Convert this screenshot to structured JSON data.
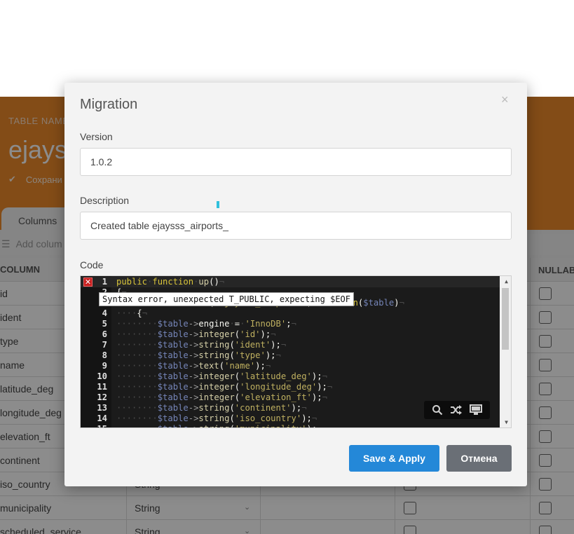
{
  "background": {
    "table_name_label": "TABLE NAME",
    "table_title": "ejays",
    "saved_text": "Сохрани",
    "tab_columns": "Columns",
    "add_column": "Add colum",
    "header": {
      "column": "COLUMN",
      "nullable": "NULLABL"
    },
    "rows": [
      {
        "name": "id",
        "type": ""
      },
      {
        "name": "ident",
        "type": ""
      },
      {
        "name": "type",
        "type": ""
      },
      {
        "name": "name",
        "type": ""
      },
      {
        "name": "latitude_deg",
        "type": ""
      },
      {
        "name": "longitude_deg",
        "type": ""
      },
      {
        "name": "elevation_ft",
        "type": ""
      },
      {
        "name": "continent",
        "type": ""
      },
      {
        "name": "iso_country",
        "type": "String"
      },
      {
        "name": "municipality",
        "type": "String"
      },
      {
        "name": "scheduled_service",
        "type": "String"
      }
    ]
  },
  "modal": {
    "title": "Migration",
    "close_glyph": "×",
    "version_label": "Version",
    "version_value": "1.0.2",
    "description_label": "Description",
    "description_value": "Created table ejaysss_airports_",
    "code_label": "Code",
    "error_tooltip": "Syntax error, unexpected T_PUBLIC, expecting $EOF",
    "code_lines": [
      {
        "n": "1",
        "text": "public function up()"
      },
      {
        "n": "2",
        "text": "{"
      },
      {
        "n": "3",
        "text": "    Schema::create('ejaysss_airports', function($table)"
      },
      {
        "n": "4",
        "text": "    {"
      },
      {
        "n": "5",
        "text": "        $table->engine = 'InnoDB';"
      },
      {
        "n": "6",
        "text": "        $table->integer('id');"
      },
      {
        "n": "7",
        "text": "        $table->string('ident');"
      },
      {
        "n": "8",
        "text": "        $table->string('type');"
      },
      {
        "n": "9",
        "text": "        $table->text('name');"
      },
      {
        "n": "10",
        "text": "        $table->integer('latitude_deg');"
      },
      {
        "n": "11",
        "text": "        $table->integer('longitude_deg');"
      },
      {
        "n": "12",
        "text": "        $table->integer('elevation_ft');"
      },
      {
        "n": "13",
        "text": "        $table->string('continent');"
      },
      {
        "n": "14",
        "text": "        $table->string('iso_country');"
      },
      {
        "n": "15",
        "text": "        $table->string('municipality');"
      }
    ],
    "editor_tools": [
      "search-icon",
      "shuffle-icon",
      "monitor-icon"
    ],
    "save_button": "Save & Apply",
    "cancel_button": "Отмена"
  },
  "colors": {
    "accent_orange": "#ef8a2b",
    "primary_button": "#2488d8",
    "secondary_button": "#6a6f76",
    "editor_bg": "#1b1b1b",
    "error_red": "#c82020"
  }
}
